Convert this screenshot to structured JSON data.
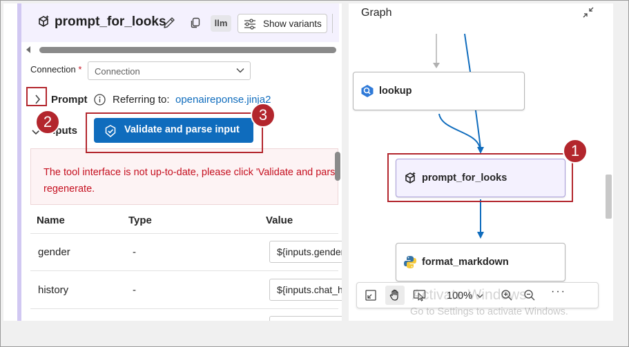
{
  "node": {
    "title": "prompt_for_looks",
    "type_badge": "llm",
    "show_variants_label": "Show variants"
  },
  "connection": {
    "label": "Connection",
    "required_mark": "*",
    "placeholder": "Connection"
  },
  "prompt": {
    "label": "Prompt",
    "referring_label": "Referring to:",
    "referring_link": "openaireponse.jinja2"
  },
  "inputs": {
    "label": "Inputs",
    "validate_button": "Validate and parse input",
    "error_line1": "The tool interface is not up-to-date, please click 'Validate and parse input' to",
    "error_line2": "regenerate.",
    "columns": [
      "Name",
      "Type",
      "Value"
    ],
    "rows": [
      {
        "name": "gender",
        "type": "-",
        "value": "${inputs.gender}"
      },
      {
        "name": "history",
        "type": "-",
        "value": "${inputs.chat_history}"
      }
    ]
  },
  "graph": {
    "title": "Graph",
    "nodes": [
      "lookup",
      "prompt_for_looks",
      "format_markdown"
    ],
    "zoom": "100%",
    "more": "···",
    "watermark_line1": "Activate Windows",
    "watermark_line2": "Go to Settings to activate Windows."
  },
  "callouts": {
    "one": "1",
    "two": "2",
    "three": "3"
  },
  "colors": {
    "accent_blue": "#0f6cbd",
    "callout_red": "#b3262d",
    "error_red": "#c50f1f",
    "selected_node_bg": "#f4f1fe"
  }
}
